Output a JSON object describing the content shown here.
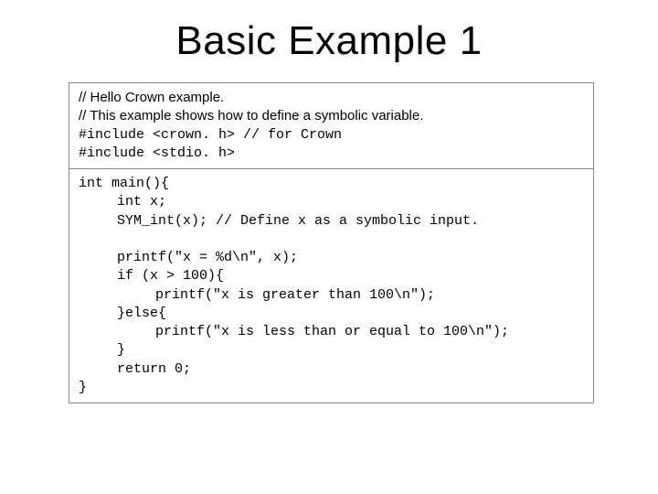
{
  "title": "Basic Example 1",
  "header": {
    "l1_sans": "// Hello Crown example.",
    "l2_sans": "// This example shows how to define a symbolic variable.",
    "l3_mono": "#include <crown. h> // for Crown",
    "l4_mono": "#include <stdio. h>"
  },
  "body": {
    "l1": "int main(){",
    "l2": "int x;",
    "l3": "SYM_int(x); // Define x as a symbolic input.",
    "blank1": " ",
    "l4": "printf(\"x = %d\\n\", x);",
    "l5": "if (x > 100){",
    "l6": "printf(\"x is greater than 100\\n\");",
    "l7": "}else{",
    "l8": "printf(\"x is less than or equal to 100\\n\");",
    "l9": "}",
    "l10": "return 0;",
    "l11": "}"
  }
}
